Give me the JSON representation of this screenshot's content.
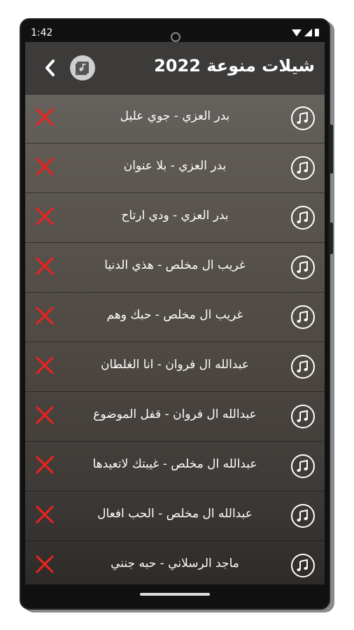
{
  "status": {
    "time": "1:42"
  },
  "appbar": {
    "title": "شيلات منوعة 2022"
  },
  "tracks": [
    "بدر العزي - جوي عليل",
    "بدر العزي - بلا عنوان",
    "بدر العزي - ودي ارتاح",
    "غريب ال مخلص - هذي الدنيا",
    "غريب ال مخلص - حبك وهم",
    "عبدالله ال فروان - انا الغلطان",
    "عبدالله ال فروان - قفل الموضوع",
    "عبدالله ال مخلص - غيبتك لاتعيدها",
    "عبدالله ال مخلص - الحب افعال",
    "ماجد الرسلاني - حبه جنني"
  ],
  "colors": {
    "delete": "#e8231e",
    "appbar": "#3d3b39"
  }
}
